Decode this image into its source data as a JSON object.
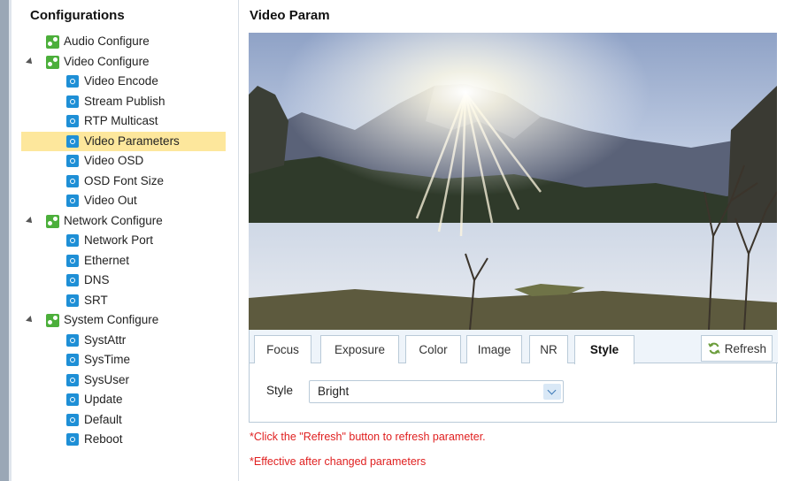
{
  "sidebar": {
    "title": "Configurations",
    "items": [
      {
        "label": "Audio Configure",
        "kind": "cat-leaf",
        "icon": "gear-group-icon"
      },
      {
        "label": "Video Configure",
        "kind": "cat",
        "icon": "gear-group-icon"
      },
      {
        "label": "Video Encode",
        "kind": "leaf",
        "icon": "gear-icon"
      },
      {
        "label": "Stream Publish",
        "kind": "leaf",
        "icon": "gear-icon"
      },
      {
        "label": "RTP Multicast",
        "kind": "leaf",
        "icon": "gear-icon"
      },
      {
        "label": "Video Parameters",
        "kind": "leaf",
        "icon": "gear-icon",
        "selected": true
      },
      {
        "label": "Video OSD",
        "kind": "leaf",
        "icon": "gear-icon"
      },
      {
        "label": "OSD Font Size",
        "kind": "leaf",
        "icon": "gear-icon"
      },
      {
        "label": "Video Out",
        "kind": "leaf",
        "icon": "gear-icon"
      },
      {
        "label": "Network Configure",
        "kind": "cat",
        "icon": "gear-group-icon"
      },
      {
        "label": "Network Port",
        "kind": "leaf",
        "icon": "gear-icon"
      },
      {
        "label": "Ethernet",
        "kind": "leaf",
        "icon": "gear-icon"
      },
      {
        "label": "DNS",
        "kind": "leaf",
        "icon": "gear-icon"
      },
      {
        "label": "SRT",
        "kind": "leaf",
        "icon": "gear-icon"
      },
      {
        "label": "System Configure",
        "kind": "cat",
        "icon": "gear-group-icon"
      },
      {
        "label": "SystAttr",
        "kind": "leaf",
        "icon": "gear-icon"
      },
      {
        "label": "SysTime",
        "kind": "leaf",
        "icon": "gear-icon"
      },
      {
        "label": "SysUser",
        "kind": "leaf",
        "icon": "gear-icon"
      },
      {
        "label": "Update",
        "kind": "leaf",
        "icon": "gear-icon"
      },
      {
        "label": "Default",
        "kind": "leaf",
        "icon": "gear-icon"
      },
      {
        "label": "Reboot",
        "kind": "leaf",
        "icon": "gear-icon"
      }
    ]
  },
  "main": {
    "title": "Video Param",
    "tabs": [
      {
        "label": "Focus"
      },
      {
        "label": "Exposure"
      },
      {
        "label": "Color"
      },
      {
        "label": "Image"
      },
      {
        "label": "NR"
      },
      {
        "label": "Style",
        "active": true
      }
    ],
    "refresh_label": "Refresh",
    "style_label": "Style",
    "style_value": "Bright",
    "note1": "*Click the \"Refresh\" button to refresh parameter.",
    "note2": "*Effective after changed parameters"
  },
  "colors": {
    "accent": "#1e8fd6",
    "category_icon": "#4caf3b",
    "selection": "#fde79c",
    "note": "#e02020"
  }
}
